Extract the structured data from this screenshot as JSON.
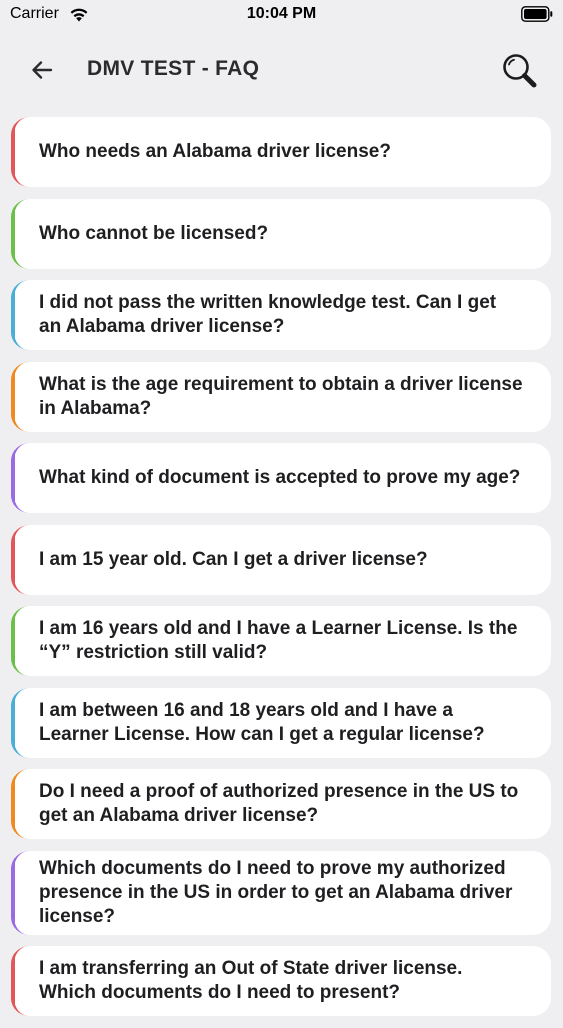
{
  "status_bar": {
    "carrier": "Carrier",
    "time": "10:04 PM"
  },
  "nav": {
    "title": "DMV TEST - FAQ",
    "back_icon": "arrow-left-icon",
    "search_icon": "search-icon"
  },
  "colors": {
    "red": "#e2585a",
    "green": "#6cc04a",
    "blue": "#4aaed6",
    "orange": "#ef8a22",
    "purple": "#9a6be3"
  },
  "faq": [
    {
      "question": "Who needs an Alabama driver license?",
      "accent": "red"
    },
    {
      "question": "Who cannot be licensed?",
      "accent": "green"
    },
    {
      "question": "I did not pass the written knowledge test. Can I get an Alabama driver license?",
      "accent": "blue"
    },
    {
      "question": "What is the age requirement to obtain a driver license in Alabama?",
      "accent": "orange"
    },
    {
      "question": "What kind of document is accepted to prove my age?",
      "accent": "purple"
    },
    {
      "question": "I am 15 year old. Can I get a driver license?",
      "accent": "red"
    },
    {
      "question": "I am 16 years old and I have a Learner License. Is the “Y” restriction still valid?",
      "accent": "green"
    },
    {
      "question": "I am between 16 and 18 years old and I have a Learner License. How can I get a regular license?",
      "accent": "blue"
    },
    {
      "question": "Do I need a proof of authorized presence in the US to get an Alabama driver license?",
      "accent": "orange"
    },
    {
      "question": "Which documents do I need to prove my authorized presence in the US in order to get an Alabama driver license?",
      "accent": "purple"
    },
    {
      "question": "I am transferring an Out of State driver license. Which documents do I need to present?",
      "accent": "red"
    }
  ]
}
